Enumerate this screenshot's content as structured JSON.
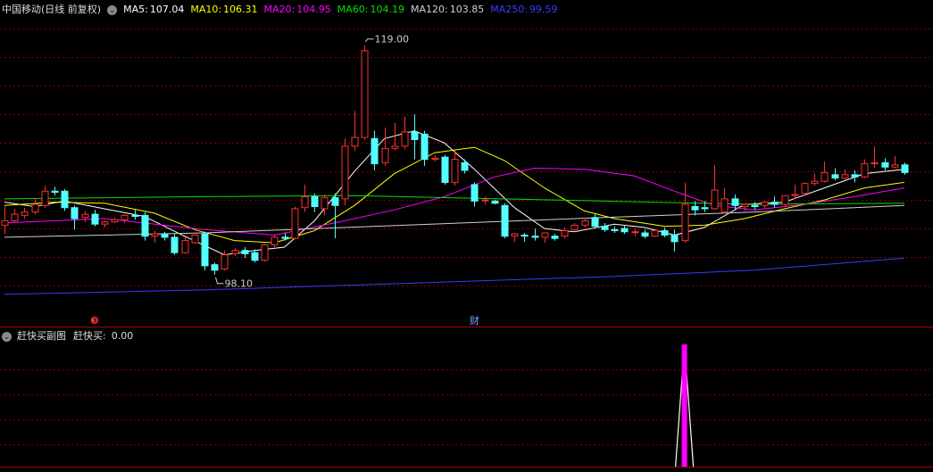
{
  "header": {
    "title": "中国移动(日线 前复权)",
    "ma_items": [
      {
        "label": "MA5:",
        "value": "107.04",
        "color": "#ffffff"
      },
      {
        "label": "MA10:",
        "value": "106.31",
        "color": "#ffff00"
      },
      {
        "label": "MA20:",
        "value": "104.95",
        "color": "#ff00ff"
      },
      {
        "label": "MA60:",
        "value": "104.19",
        "color": "#00e000"
      },
      {
        "label": "MA120:",
        "value": "103.85",
        "color": "#d0d0d0"
      },
      {
        "label": "MA250:",
        "value": "99.59",
        "color": "#3a3aff"
      }
    ]
  },
  "sub_header": {
    "title": "赶快买副图",
    "indicator_label": "赶快买:",
    "indicator_value": "0.00"
  },
  "chart_data": {
    "type": "candlestick",
    "y_range": [
      94.5,
      121.5
    ],
    "colors": {
      "up": "#ff3030",
      "down": "#54ffff",
      "grid": "#800000",
      "signal": "#ff00ff"
    },
    "annotations": {
      "high_label": "119.00",
      "low_label": "98.10",
      "event_marker_1": "❸",
      "event_marker_2": "财"
    },
    "candles": [
      [
        102.6,
        104.3,
        103.0,
        101.8
      ],
      [
        103.0,
        104.1,
        103.6,
        102.9
      ],
      [
        103.5,
        104.2,
        103.8,
        103.2
      ],
      [
        103.8,
        105.0,
        104.5,
        103.6
      ],
      [
        104.4,
        106.2,
        105.7,
        104.2
      ],
      [
        105.7,
        106.1,
        105.6,
        105.3
      ],
      [
        105.7,
        105.9,
        104.2,
        103.9
      ],
      [
        104.2,
        104.4,
        103.2,
        102.2
      ],
      [
        103.3,
        103.9,
        103.6,
        102.9
      ],
      [
        103.6,
        104.0,
        102.7,
        102.5
      ],
      [
        102.7,
        103.0,
        102.9,
        102.4
      ],
      [
        102.9,
        103.3,
        103.1,
        102.8
      ],
      [
        103.1,
        103.6,
        103.5,
        102.8
      ],
      [
        103.5,
        104.0,
        103.4,
        103.1
      ],
      [
        103.5,
        103.8,
        101.6,
        101.2
      ],
      [
        101.6,
        102.1,
        101.8,
        101.0
      ],
      [
        101.8,
        102.0,
        101.5,
        101.2
      ],
      [
        101.5,
        101.8,
        100.1,
        99.9
      ],
      [
        100.1,
        101.5,
        101.2,
        100.0
      ],
      [
        101.0,
        101.8,
        101.7,
        100.9
      ],
      [
        101.8,
        102.0,
        98.9,
        98.5
      ],
      [
        99.0,
        99.2,
        98.5,
        98.1
      ],
      [
        98.6,
        100.3,
        99.9,
        98.5
      ],
      [
        100.0,
        100.5,
        100.3,
        99.8
      ],
      [
        100.3,
        100.6,
        100.0,
        99.6
      ],
      [
        100.1,
        100.4,
        99.4,
        99.2
      ],
      [
        99.4,
        100.9,
        100.8,
        99.3
      ],
      [
        100.8,
        101.8,
        101.5,
        100.6
      ],
      [
        101.5,
        101.9,
        101.4,
        101.2
      ],
      [
        101.4,
        104.3,
        104.1,
        101.3
      ],
      [
        104.2,
        106.3,
        105.2,
        103.8
      ],
      [
        105.2,
        105.5,
        104.3,
        103.8
      ],
      [
        104.1,
        105.4,
        105.1,
        103.5
      ],
      [
        105.1,
        105.5,
        104.4,
        101.4
      ],
      [
        105.0,
        110.5,
        109.8,
        104.4
      ],
      [
        109.8,
        113.0,
        110.6,
        109.4
      ],
      [
        110.6,
        119.0,
        118.5,
        110.4
      ],
      [
        110.5,
        111.2,
        108.2,
        107.6
      ],
      [
        108.3,
        111.5,
        109.6,
        108.0
      ],
      [
        109.6,
        111.9,
        109.8,
        109.4
      ],
      [
        109.8,
        112.5,
        111.1,
        109.5
      ],
      [
        111.1,
        112.7,
        110.4,
        108.6
      ],
      [
        110.9,
        111.2,
        108.6,
        108.0
      ],
      [
        108.6,
        109.0,
        108.7,
        108.4
      ],
      [
        108.8,
        109.0,
        106.5,
        106.3
      ],
      [
        106.5,
        109.4,
        108.6,
        106.2
      ],
      [
        108.3,
        108.6,
        107.6,
        107.3
      ],
      [
        106.3,
        106.5,
        104.8,
        104.3
      ],
      [
        104.9,
        105.2,
        104.9,
        104.5
      ],
      [
        104.8,
        104.9,
        104.6,
        104.5
      ],
      [
        104.4,
        104.6,
        101.6,
        101.4
      ],
      [
        101.6,
        101.9,
        101.8,
        101.1
      ],
      [
        101.7,
        101.9,
        101.6,
        101.1
      ],
      [
        101.6,
        102.3,
        101.5,
        101.2
      ],
      [
        101.5,
        101.7,
        101.9,
        101.0
      ],
      [
        101.6,
        101.8,
        101.4,
        101.2
      ],
      [
        101.6,
        102.4,
        102.1,
        101.4
      ],
      [
        102.2,
        102.8,
        102.6,
        102.0
      ],
      [
        102.6,
        103.3,
        103.0,
        102.4
      ],
      [
        103.3,
        103.6,
        102.5,
        102.3
      ],
      [
        102.5,
        102.8,
        102.2,
        102.0
      ],
      [
        102.2,
        102.5,
        102.1,
        101.9
      ],
      [
        102.3,
        102.6,
        102.0,
        101.8
      ],
      [
        102.0,
        102.3,
        102.0,
        101.6
      ],
      [
        101.9,
        102.2,
        101.6,
        101.4
      ],
      [
        101.6,
        102.3,
        102.1,
        101.5
      ],
      [
        102.1,
        102.4,
        101.7,
        101.5
      ],
      [
        101.7,
        102.2,
        101.1,
        100.2
      ],
      [
        101.2,
        106.5,
        104.5,
        101.0
      ],
      [
        104.3,
        104.8,
        104.0,
        103.5
      ],
      [
        104.2,
        104.8,
        104.1,
        103.8
      ],
      [
        104.1,
        108.1,
        105.8,
        104.0
      ],
      [
        103.8,
        106.0,
        105.0,
        103.7
      ],
      [
        105.0,
        105.4,
        104.4,
        104.0
      ],
      [
        104.3,
        104.6,
        104.5,
        103.9
      ],
      [
        104.4,
        104.7,
        104.3,
        104.0
      ],
      [
        104.4,
        104.8,
        104.7,
        104.1
      ],
      [
        104.7,
        105.2,
        104.5,
        104.2
      ],
      [
        104.5,
        104.9,
        105.3,
        104.3
      ],
      [
        105.3,
        106.3,
        105.4,
        105.0
      ],
      [
        105.5,
        106.5,
        106.4,
        105.3
      ],
      [
        106.4,
        107.3,
        106.6,
        106.2
      ],
      [
        106.6,
        108.4,
        107.4,
        106.5
      ],
      [
        107.2,
        107.8,
        106.9,
        106.7
      ],
      [
        106.9,
        107.7,
        107.2,
        106.8
      ],
      [
        107.2,
        107.6,
        107.0,
        106.5
      ],
      [
        107.0,
        108.6,
        108.2,
        106.9
      ],
      [
        108.2,
        109.8,
        108.3,
        107.8
      ],
      [
        108.3,
        108.7,
        107.9,
        107.6
      ],
      [
        107.9,
        108.9,
        108.1,
        107.8
      ],
      [
        108.1,
        108.3,
        107.4,
        107.2
      ]
    ],
    "ma_series": [
      {
        "name": "MA5",
        "color": "#ffffff",
        "points": [
          [
            0,
            104.7
          ],
          [
            3,
            104.3
          ],
          [
            6,
            104.8
          ],
          [
            10,
            104.1
          ],
          [
            14,
            103.4
          ],
          [
            18,
            101.6
          ],
          [
            22,
            99.9
          ],
          [
            25,
            100.3
          ],
          [
            28,
            100.6
          ],
          [
            31,
            103.0
          ],
          [
            35,
            107.5
          ],
          [
            38,
            110.5
          ],
          [
            41,
            111.2
          ],
          [
            44,
            110.1
          ],
          [
            47,
            107.7
          ],
          [
            51,
            104.2
          ],
          [
            54,
            102.3
          ],
          [
            57,
            102.0
          ],
          [
            61,
            102.7
          ],
          [
            64,
            102.4
          ],
          [
            67,
            101.7
          ],
          [
            70,
            102.4
          ],
          [
            74,
            104.5
          ],
          [
            78,
            104.7
          ],
          [
            82,
            106.0
          ],
          [
            86,
            107.3
          ],
          [
            90,
            107.7
          ]
        ]
      },
      {
        "name": "MA10",
        "color": "#ffff00",
        "points": [
          [
            0,
            104.4
          ],
          [
            5,
            104.7
          ],
          [
            10,
            104.6
          ],
          [
            15,
            103.7
          ],
          [
            19,
            102.2
          ],
          [
            23,
            101.2
          ],
          [
            27,
            101.0
          ],
          [
            31,
            102.1
          ],
          [
            35,
            104.4
          ],
          [
            39,
            107.3
          ],
          [
            43,
            109.2
          ],
          [
            47,
            109.7
          ],
          [
            50,
            108.5
          ],
          [
            54,
            106.0
          ],
          [
            58,
            103.9
          ],
          [
            61,
            103.2
          ],
          [
            66,
            102.5
          ],
          [
            70,
            102.6
          ],
          [
            74,
            103.2
          ],
          [
            78,
            104.1
          ],
          [
            82,
            104.9
          ],
          [
            86,
            106.0
          ],
          [
            90,
            106.5
          ]
        ]
      },
      {
        "name": "MA20",
        "color": "#ff00ff",
        "points": [
          [
            0,
            102.8
          ],
          [
            10,
            103.2
          ],
          [
            20,
            102.2
          ],
          [
            27,
            101.7
          ],
          [
            33,
            102.8
          ],
          [
            39,
            104.0
          ],
          [
            44,
            105.2
          ],
          [
            49,
            107.0
          ],
          [
            53,
            107.8
          ],
          [
            58,
            107.7
          ],
          [
            63,
            107.1
          ],
          [
            67,
            105.7
          ],
          [
            71,
            104.4
          ],
          [
            75,
            104.0
          ],
          [
            80,
            104.5
          ],
          [
            85,
            105.2
          ],
          [
            90,
            106.0
          ]
        ]
      },
      {
        "name": "MA60",
        "color": "#00e000",
        "points": [
          [
            0,
            105.0
          ],
          [
            20,
            105.2
          ],
          [
            35,
            105.3
          ],
          [
            45,
            105.1
          ],
          [
            55,
            104.9
          ],
          [
            65,
            104.7
          ],
          [
            75,
            104.5
          ],
          [
            90,
            104.6
          ]
        ]
      },
      {
        "name": "MA120",
        "color": "#d0d0d0",
        "points": [
          [
            0,
            101.5
          ],
          [
            20,
            101.9
          ],
          [
            40,
            102.6
          ],
          [
            60,
            103.3
          ],
          [
            75,
            103.8
          ],
          [
            90,
            104.4
          ]
        ]
      },
      {
        "name": "MA250",
        "color": "#3a3aff",
        "points": [
          [
            0,
            96.3
          ],
          [
            20,
            96.7
          ],
          [
            40,
            97.3
          ],
          [
            60,
            97.9
          ],
          [
            75,
            98.5
          ],
          [
            90,
            99.6
          ]
        ]
      }
    ],
    "indicator": {
      "name": "赶快买",
      "values_nonzero": [
        {
          "index": 68,
          "value": 1
        }
      ],
      "y_range": [
        0,
        1
      ]
    }
  }
}
